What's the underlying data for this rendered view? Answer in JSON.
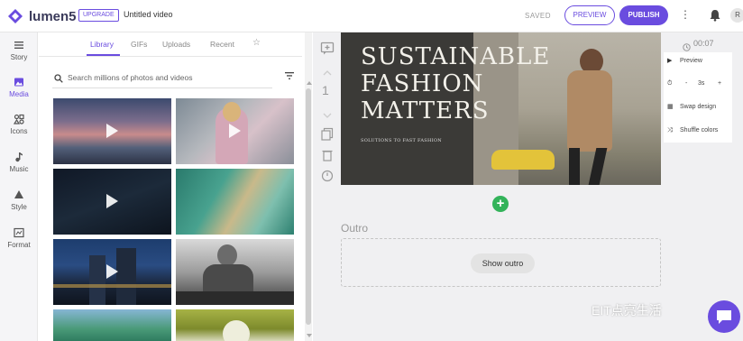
{
  "app": {
    "name": "lumen5",
    "upgrade_label": "UPGRADE",
    "document_title": "Untitled video",
    "saved_status": "SAVED",
    "preview_label": "PREVIEW",
    "publish_label": "PUBLISH",
    "avatar_initial": "R"
  },
  "sidebar": {
    "items": [
      {
        "label": "Story",
        "icon": "story-icon"
      },
      {
        "label": "Media",
        "icon": "media-icon"
      },
      {
        "label": "Icons",
        "icon": "icons-icon"
      },
      {
        "label": "Music",
        "icon": "music-icon"
      },
      {
        "label": "Style",
        "icon": "style-icon"
      },
      {
        "label": "Format",
        "icon": "format-icon"
      }
    ]
  },
  "media_panel": {
    "tabs": [
      "Library",
      "GIFs",
      "Uploads",
      "Recent"
    ],
    "search_placeholder": "Search millions of photos and videos"
  },
  "scene": {
    "number": "1",
    "slide_title_lines": [
      "SUSTAINABLE",
      "FASHION",
      "MATTERS"
    ],
    "slide_subtitle": "SOLUTIONS TO FAST FASHION",
    "outro_label": "Outro",
    "show_outro_label": "Show outro"
  },
  "scene_controls": {
    "duration": "00:07",
    "preview_label": "Preview",
    "seconds": "3s",
    "minus": "-",
    "plus": "+",
    "swap_design_label": "Swap design",
    "shuffle_colors_label": "Shuffle colors"
  },
  "overlay": {
    "watermark_text": "EIT点亮生活"
  },
  "colors": {
    "accent": "#6a4cdf",
    "add_button": "#33b35a"
  }
}
